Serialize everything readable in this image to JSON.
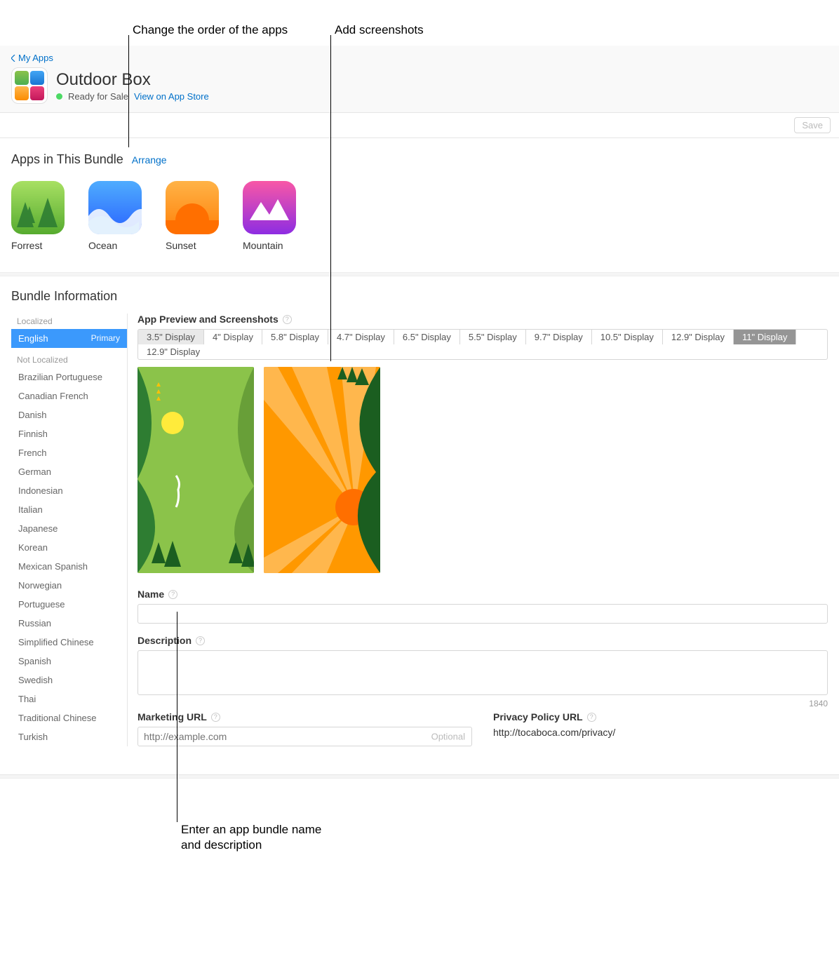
{
  "callouts": {
    "reorder": "Change the order of the apps",
    "addshots": "Add screenshots",
    "enter_name": "Enter an app bundle name and description"
  },
  "header": {
    "back": "My Apps",
    "title": "Outdoor Box",
    "status": "Ready for Sale",
    "view_link": "View on App Store"
  },
  "save_label": "Save",
  "apps_section": {
    "title": "Apps in This Bundle",
    "arrange": "Arrange",
    "apps": [
      {
        "name": "Forrest"
      },
      {
        "name": "Ocean"
      },
      {
        "name": "Sunset"
      },
      {
        "name": "Mountain"
      }
    ]
  },
  "bundle_info": {
    "title": "Bundle Information",
    "localized_label": "Localized",
    "not_localized_label": "Not Localized",
    "active_lang": "English",
    "primary_label": "Primary",
    "languages": [
      "Brazilian Portuguese",
      "Canadian French",
      "Danish",
      "Finnish",
      "French",
      "German",
      "Indonesian",
      "Italian",
      "Japanese",
      "Korean",
      "Mexican Spanish",
      "Norwegian",
      "Portuguese",
      "Russian",
      "Simplified Chinese",
      "Spanish",
      "Swedish",
      "Thai",
      "Traditional Chinese",
      "Turkish"
    ],
    "preview_label": "App Preview and Screenshots",
    "display_tabs": [
      "3.5\" Display",
      "4\" Display",
      "5.8\" Display",
      "4.7\" Display",
      "6.5\" Display",
      "5.5\" Display",
      "9.7\" Display",
      "10.5\" Display",
      "12.9\" Display",
      "11\" Display",
      "12.9\" Display"
    ],
    "name_label": "Name",
    "name_value": "",
    "desc_label": "Description",
    "desc_value": "",
    "char_count": "1840",
    "marketing_label": "Marketing URL",
    "marketing_placeholder": "http://example.com",
    "marketing_optional": "Optional",
    "privacy_label": "Privacy Policy URL",
    "privacy_url": "http://tocaboca.com/privacy/"
  }
}
